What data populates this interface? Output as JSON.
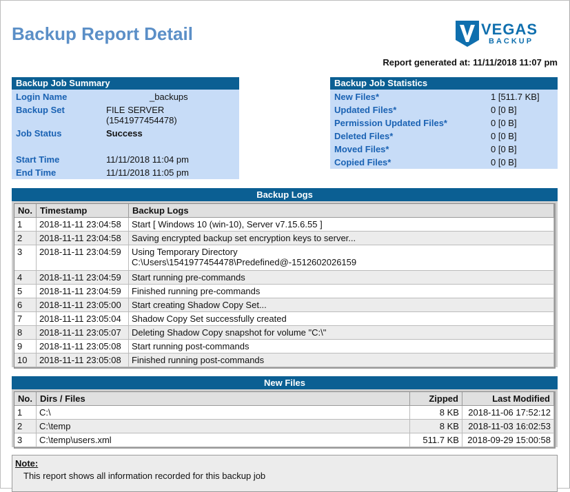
{
  "header": {
    "title": "Backup Report Detail",
    "logo_main": "VEGAS",
    "logo_sub": "BACKUP",
    "generated_label": "Report generated at:",
    "generated_value": "11/11/2018 11:07 pm"
  },
  "summary": {
    "title": "Backup Job Summary",
    "rows": [
      {
        "key": "Login Name",
        "value": "_backups"
      },
      {
        "key": "Backup Set",
        "value": "FILE SERVER",
        "value2": "(1541977454478)"
      },
      {
        "key": "Job Status",
        "value": "Success"
      },
      {
        "key": "Start Time",
        "value": "11/11/2018 11:04 pm"
      },
      {
        "key": "End Time",
        "value": "11/11/2018 11:05 pm"
      }
    ]
  },
  "statistics": {
    "title": "Backup Job Statistics",
    "rows": [
      {
        "key": "New Files*",
        "value": "1 [511.7 KB]"
      },
      {
        "key": "Updated Files*",
        "value": "0 [0 B]"
      },
      {
        "key": "Permission Updated Files*",
        "value": "0 [0 B]"
      },
      {
        "key": "Deleted Files*",
        "value": "0 [0 B]"
      },
      {
        "key": "Moved Files*",
        "value": "0 [0 B]"
      },
      {
        "key": "Copied Files*",
        "value": "0 [0 B]"
      }
    ]
  },
  "logs": {
    "title": "Backup Logs",
    "columns": [
      "No.",
      "Timestamp",
      "Backup Logs"
    ],
    "rows": [
      [
        "1",
        "2018-11-11 23:04:58",
        "Start [ Windows 10 (win-10), Server v7.15.6.55 ]"
      ],
      [
        "2",
        "2018-11-11 23:04:58",
        "Saving encrypted backup set encryption keys to server..."
      ],
      [
        "3",
        "2018-11-11 23:04:59",
        "Using Temporary Directory",
        "C:\\Users\\1541977454478\\Predefined@-1512602026159"
      ],
      [
        "4",
        "2018-11-11 23:04:59",
        "Start running pre-commands"
      ],
      [
        "5",
        "2018-11-11 23:04:59",
        "Finished running pre-commands"
      ],
      [
        "6",
        "2018-11-11 23:05:00",
        "Start creating Shadow Copy Set..."
      ],
      [
        "7",
        "2018-11-11 23:05:04",
        "Shadow Copy Set successfully created"
      ],
      [
        "8",
        "2018-11-11 23:05:07",
        "Deleting Shadow Copy snapshot for volume \"C:\\\""
      ],
      [
        "9",
        "2018-11-11 23:05:08",
        "Start running post-commands"
      ],
      [
        "10",
        "2018-11-11 23:05:08",
        "Finished running post-commands"
      ]
    ]
  },
  "new_files": {
    "title": "New Files",
    "columns": [
      "No.",
      "Dirs / Files",
      "Zipped",
      "Last Modified"
    ],
    "rows": [
      [
        "1",
        "C:\\",
        "8 KB",
        "2018-11-06 17:52:12"
      ],
      [
        "2",
        "C:\\temp",
        "8 KB",
        "2018-11-03 16:02:53"
      ],
      [
        "3",
        "C:\\temp\\users.xml",
        "511.7 KB",
        "2018-09-29 15:00:58"
      ]
    ]
  },
  "note": {
    "title": "Note:",
    "text": "This report shows all information recorded for this backup job"
  }
}
